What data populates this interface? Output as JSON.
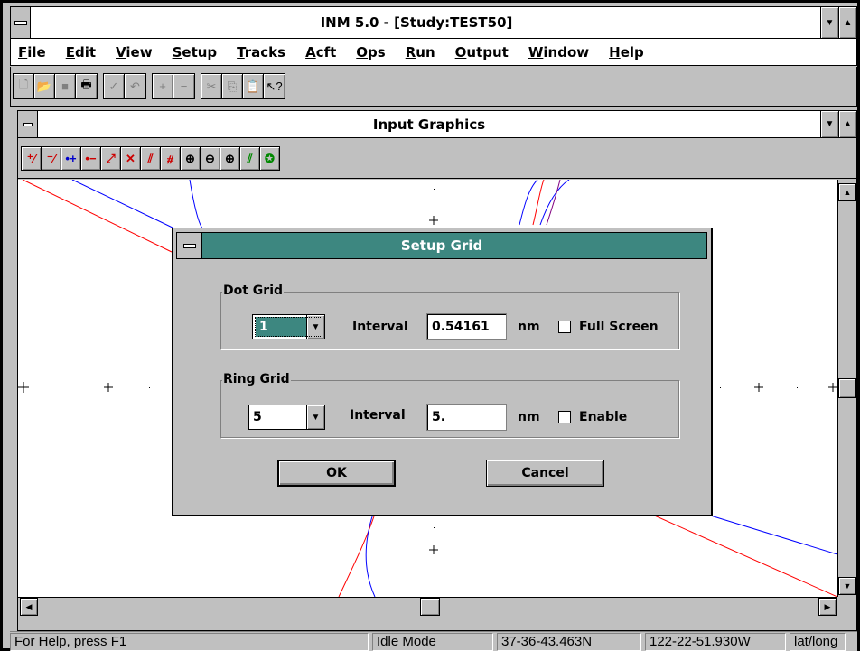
{
  "app": {
    "title": "INM 5.0 - [Study:TEST50]"
  },
  "menu": {
    "items": [
      {
        "u": "F",
        "rest": "ile"
      },
      {
        "u": "E",
        "rest": "dit"
      },
      {
        "u": "V",
        "rest": "iew"
      },
      {
        "u": "S",
        "rest": "etup"
      },
      {
        "u": "T",
        "rest": "racks"
      },
      {
        "u": "A",
        "rest": "cft"
      },
      {
        "u": "O",
        "rest": "ps"
      },
      {
        "u": "R",
        "rest": "un"
      },
      {
        "u": "O",
        "rest": "utput"
      },
      {
        "u": "W",
        "rest": "indow"
      },
      {
        "u": "H",
        "rest": "elp"
      }
    ]
  },
  "child": {
    "title": "Input Graphics"
  },
  "dialog": {
    "title": "Setup Grid",
    "dot_grid": {
      "label": "Dot Grid",
      "density_value": "1",
      "interval_label": "Interval",
      "interval_value": "0.54161",
      "unit": "nm",
      "full_screen_label": "Full Screen",
      "full_screen_checked": false
    },
    "ring_grid": {
      "label": "Ring Grid",
      "density_value": "5",
      "interval_label": "Interval",
      "interval_value": "5.",
      "unit": "nm",
      "enable_label": "Enable",
      "enable_checked": false
    },
    "ok_label": "OK",
    "cancel_label": "Cancel"
  },
  "status": {
    "help": "For Help, press F1",
    "mode": "Idle Mode",
    "lat": "37-36-43.463N",
    "long": "122-22-51.930W",
    "units": "lat/long"
  },
  "colors": {
    "dialog_title_bg": "#3d8780",
    "track_red": "#ff0000",
    "track_blue": "#0000ff"
  }
}
